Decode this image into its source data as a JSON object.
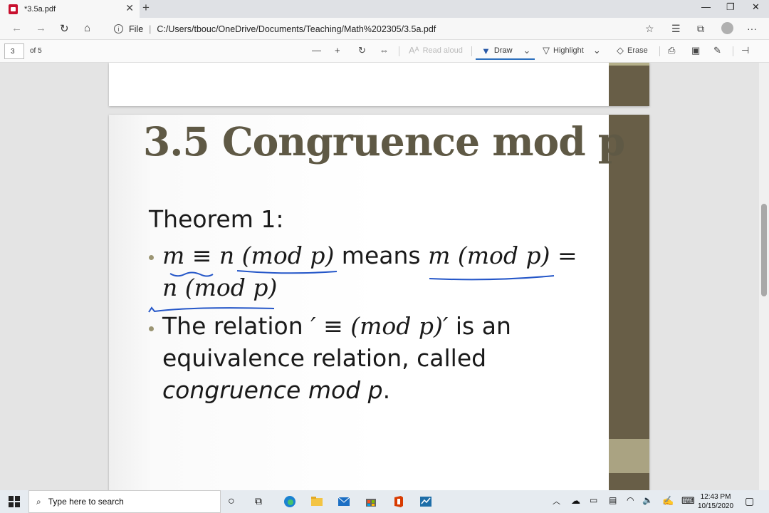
{
  "browser": {
    "tab_title": "*3.5a.pdf",
    "url_prefix": "File",
    "url": "C:/Users/tbouc/OneDrive/Documents/Teaching/Math%202305/3.5a.pdf"
  },
  "pdf_toolbar": {
    "page_number": "3",
    "page_count_label": "of 5",
    "read_aloud": "Read aloud",
    "draw": "Draw",
    "highlight": "Highlight",
    "erase": "Erase"
  },
  "slide": {
    "title": "3.5 Congruence mod p",
    "theorem_label": "Theorem 1:",
    "b1_lhs": "m ≡ n (mod p)",
    "b1_means": " means ",
    "b1_rhs": "m (mod p) =",
    "b1_line2": "n (mod p)",
    "b2_pre": "The relation ",
    "b2_math": "′ ≡  (mod p)′",
    "b2_post": " is an",
    "b2_line2": "equivalence relation, called",
    "b2_line3_italic": "congruence mod p",
    "b2_line3_end": "."
  },
  "taskbar": {
    "search_placeholder": "Type here to search",
    "time": "12:43 PM",
    "date": "10/15/2020"
  },
  "colors": {
    "title": "#5f5945",
    "sidebar_bar": "#685e47",
    "ink": "#2456c8",
    "bullet": "#9b9573"
  }
}
